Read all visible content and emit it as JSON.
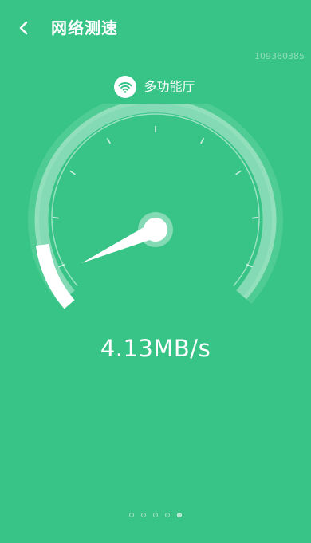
{
  "header": {
    "back_icon": "chevron-left-icon",
    "title": "网络测速"
  },
  "device_id": "109360385",
  "network": {
    "icon": "wifi-icon",
    "name": "多功能厅"
  },
  "gauge": {
    "progress": 0.12,
    "needle_progress": 0.06
  },
  "speed": {
    "value": "4.13MB/s"
  },
  "pager": {
    "count": 5,
    "active_index": 4
  },
  "colors": {
    "background": "#37c486",
    "accent": "#ffffff",
    "wifi_icon": "#37c486"
  }
}
